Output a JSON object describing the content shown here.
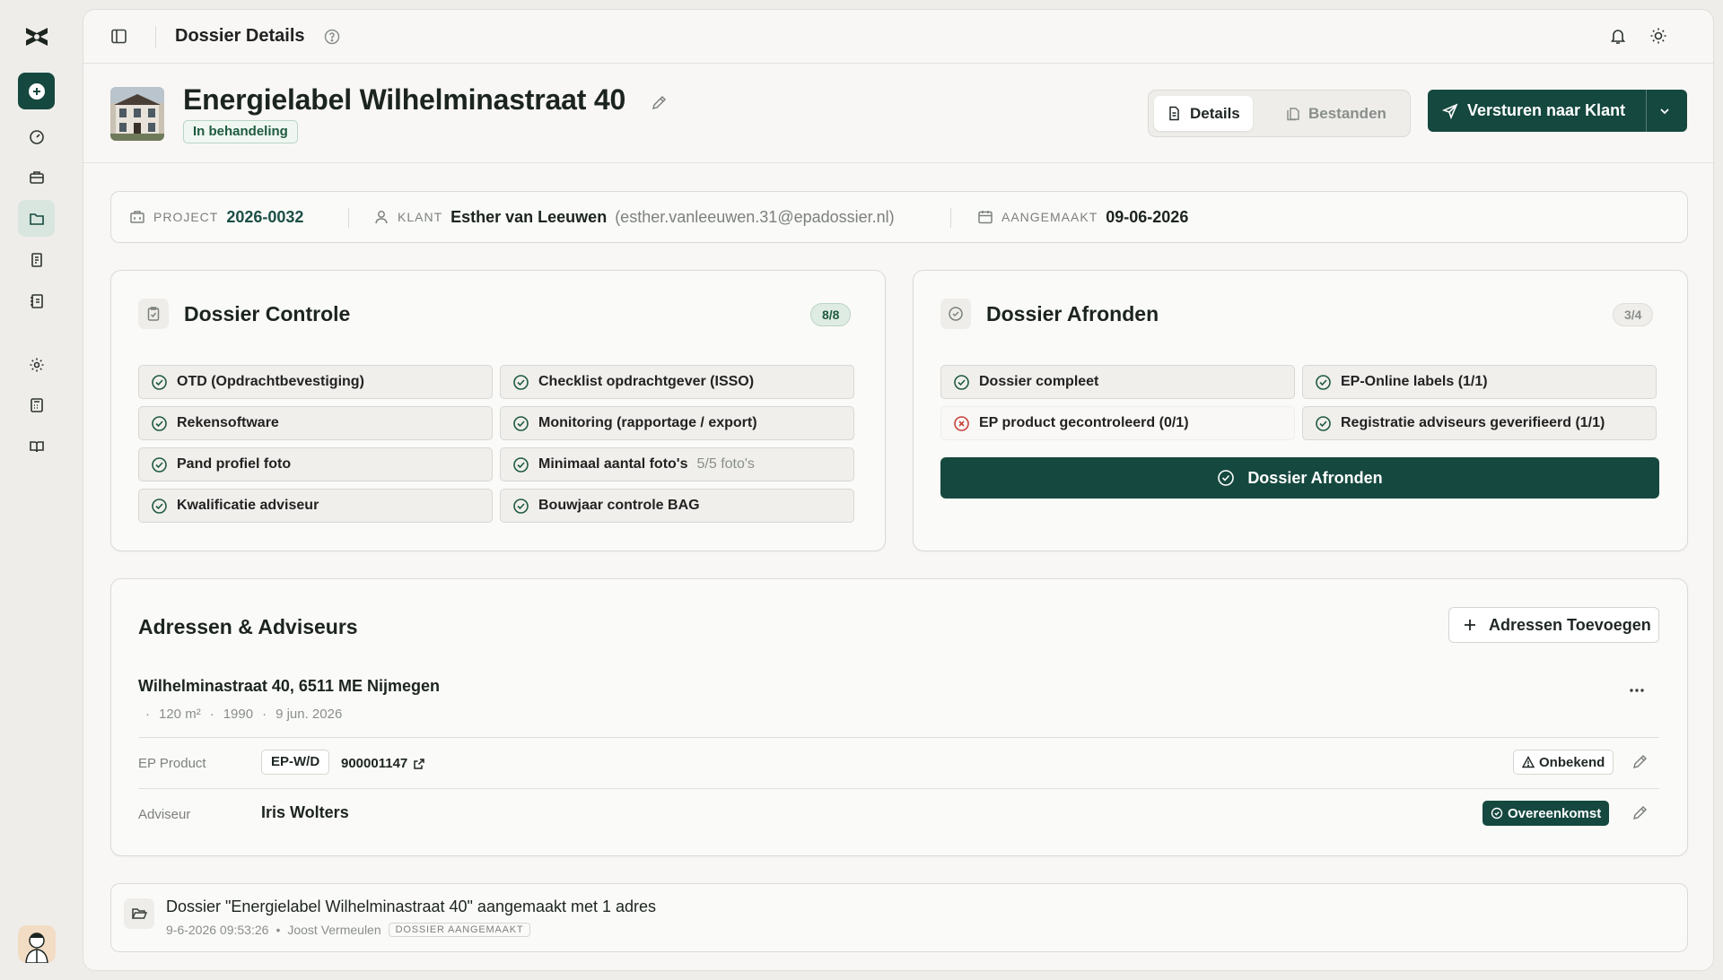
{
  "topbar": {
    "crumb": "Dossier Details"
  },
  "hero": {
    "title": "Energielabel Wilhelminastraat 40",
    "status": "In behandeling",
    "tabs": [
      {
        "label": "Details"
      },
      {
        "label": "Bestanden"
      }
    ],
    "send_label": "Versturen naar Klant"
  },
  "meta": {
    "project_label": "Project",
    "project_value": "2026-0032",
    "client_label": "Klant",
    "client_name": "Esther van Leeuwen",
    "client_email": "(esther.vanleeuwen.31@epadossier.nl)",
    "created_label": "Aangemaakt",
    "created_value": "09-06-2026"
  },
  "controle": {
    "title": "Dossier Controle",
    "count": "8/8",
    "items": [
      {
        "label": "OTD (Opdrachtbevestiging)"
      },
      {
        "label": "Checklist opdrachtgever (ISSO)"
      },
      {
        "label": "Rekensoftware"
      },
      {
        "label": "Monitoring (rapportage / export)"
      },
      {
        "label": "Pand profiel foto"
      },
      {
        "label": "Minimaal aantal foto's",
        "sub": "5/5 foto's"
      },
      {
        "label": "Kwalificatie adviseur"
      },
      {
        "label": "Bouwjaar controle BAG"
      }
    ]
  },
  "afronden": {
    "title": "Dossier Afronden",
    "count": "3/4",
    "items": [
      {
        "label": "Dossier compleet"
      },
      {
        "label": "EP-Online labels (1/1)"
      },
      {
        "label": "EP product gecontroleerd (0/1)"
      },
      {
        "label": "Registratie adviseurs geverifieerd (1/1)"
      }
    ],
    "cta_label": "Dossier Afronden"
  },
  "addresses": {
    "title": "Adressen & Adviseurs",
    "add_label": "Adressen Toevoegen",
    "address": "Wilhelminastraat 40, 6511 ME Nijmegen",
    "details": [
      "·",
      "120 m²",
      "·",
      "1990",
      "·",
      "9 jun. 2026"
    ],
    "ep_label": "EP Product",
    "ep_product": "EP-W/D",
    "ep_number": "900001147",
    "ep_status": "Onbekend",
    "advisor_label": "Adviseur",
    "advisor_name": "Iris Wolters",
    "advisor_status": "Overeenkomst"
  },
  "log": {
    "message": "Dossier \"Energielabel Wilhelminastraat 40\" aangemaakt met 1 adres",
    "timestamp": "9-6-2026 09:53:26",
    "bullet": "•",
    "user": "Joost Vermeulen",
    "tag": "Dossier aangemaakt"
  },
  "colors": {
    "brand": "#15483f",
    "success": "#1f5a3f",
    "error": "#c9413a",
    "background": "#eeedea"
  },
  "icons": [
    "logo-icon",
    "plus-circle-icon",
    "gauge-icon",
    "briefcase-icon",
    "folder-icon",
    "receipt-icon",
    "notebook-icon",
    "gear-icon",
    "calculator-icon",
    "book-icon",
    "sidebar-icon",
    "help-icon",
    "bell-icon",
    "sun-icon",
    "pencil-icon",
    "file-icon",
    "files-icon",
    "send-icon",
    "chevron-down-icon",
    "building-icon",
    "user-icon",
    "calendar-icon",
    "clipboard-check-icon",
    "check-circle-icon",
    "x-circle-icon",
    "plus-icon",
    "more-horizontal-icon",
    "external-link-icon",
    "warning-icon",
    "folder-open-icon"
  ]
}
